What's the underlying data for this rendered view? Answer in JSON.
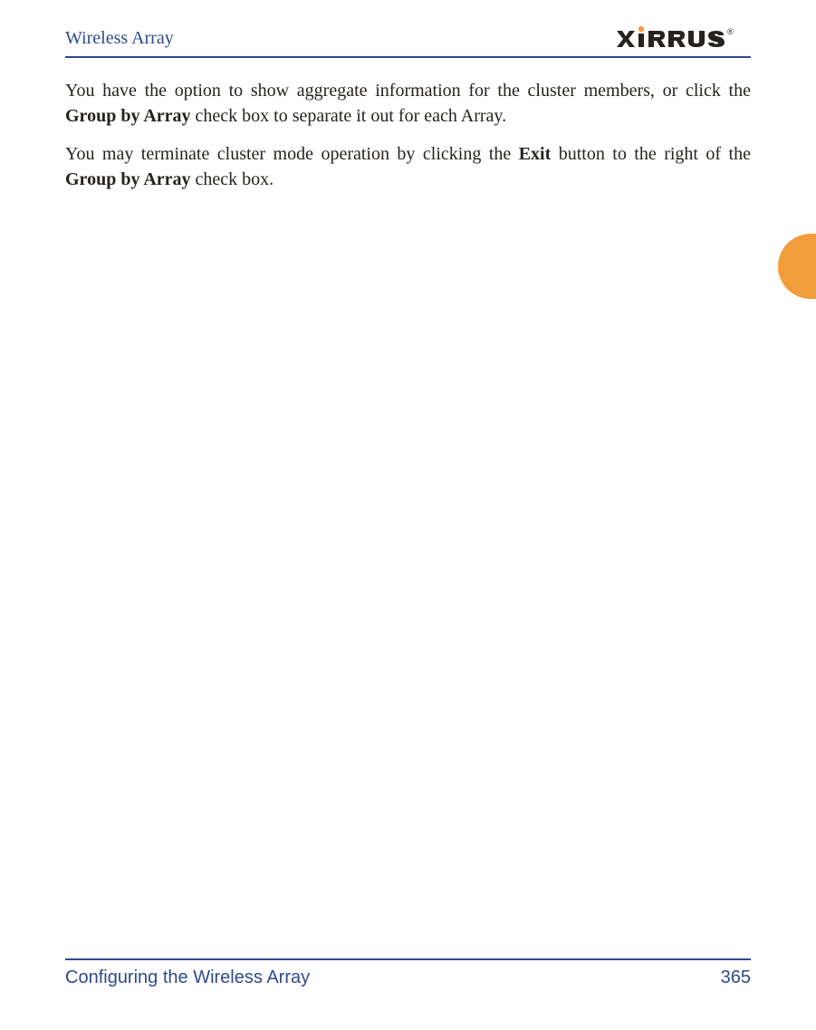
{
  "header": {
    "title": "Wireless Array",
    "logo_text": "XIRRUS",
    "logo_tm": "®"
  },
  "body": {
    "p1_a": "You have the option to show aggregate information for the cluster members, or click the ",
    "p1_b": "Group by Array",
    "p1_c": " check box to separate it out for each Array.",
    "p2_a": "You may terminate cluster mode operation by clicking the ",
    "p2_b": "Exit",
    "p2_c": " button to the right of the ",
    "p2_d": "Group by Array",
    "p2_e": " check box."
  },
  "footer": {
    "section": "Configuring the Wireless Array",
    "page_number": "365"
  }
}
